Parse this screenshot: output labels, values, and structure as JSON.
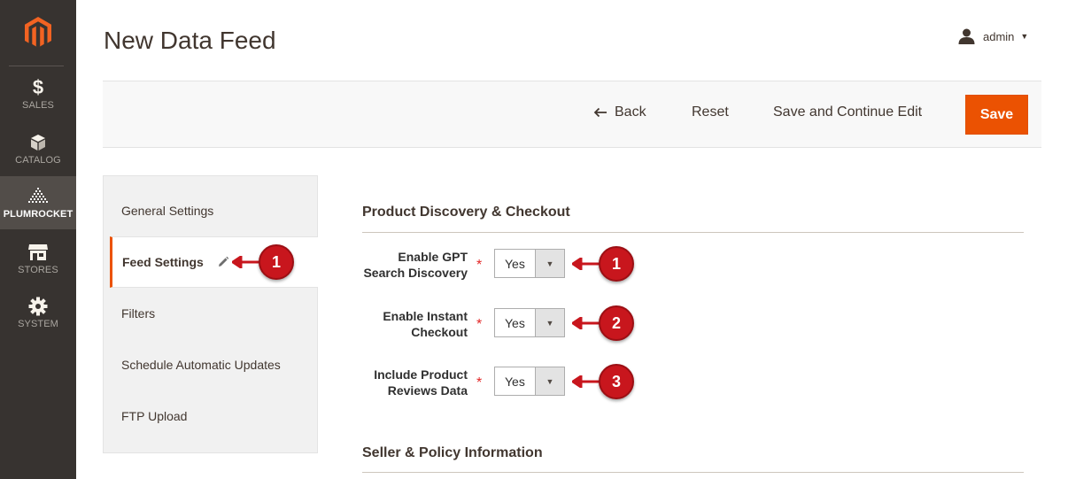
{
  "sidebar": {
    "logo_icon": "magento-logo-icon",
    "items": [
      {
        "label": "SALES",
        "icon": "dollar-icon"
      },
      {
        "label": "CATALOG",
        "icon": "cube-icon"
      },
      {
        "label": "PLUMROCKET",
        "icon": "plumrocket-icon",
        "active": true
      },
      {
        "label": "STORES",
        "icon": "store-icon"
      },
      {
        "label": "SYSTEM",
        "icon": "gear-icon"
      }
    ]
  },
  "header": {
    "title": "New Data Feed",
    "user": "admin"
  },
  "actions": {
    "back": "Back",
    "reset": "Reset",
    "save_continue": "Save and Continue Edit",
    "save": "Save"
  },
  "tabs": [
    {
      "label": "General Settings"
    },
    {
      "label": "Feed Settings",
      "active": true
    },
    {
      "label": "Filters"
    },
    {
      "label": "Schedule Automatic Updates"
    },
    {
      "label": "FTP Upload"
    }
  ],
  "sections": {
    "discovery": {
      "title": "Product Discovery & Checkout",
      "fields": [
        {
          "label_line1": "Enable GPT",
          "label_line2": "Search Discovery",
          "value": "Yes",
          "callout": "1"
        },
        {
          "label_line1": "Enable Instant",
          "label_line2": "Checkout",
          "value": "Yes",
          "callout": "2"
        },
        {
          "label_line1": "Include Product",
          "label_line2": "Reviews Data",
          "value": "Yes",
          "callout": "3"
        }
      ]
    },
    "seller": {
      "title": "Seller & Policy Information"
    }
  },
  "tab_callout": "1",
  "required_mark": "*",
  "colors": {
    "accent": "#eb5202",
    "sidebar": "#373330",
    "callout": "#c8161d"
  }
}
